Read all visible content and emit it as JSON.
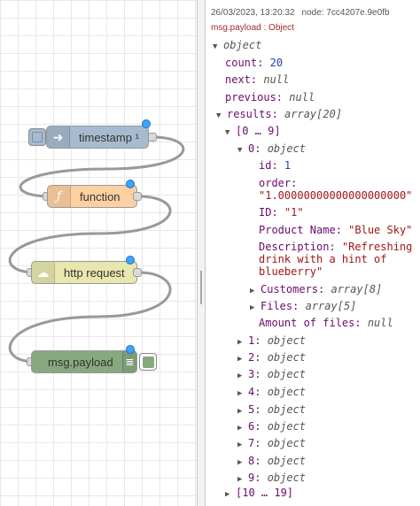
{
  "flow": {
    "nodes": [
      {
        "id": "timestamp",
        "label": "timestamp ¹",
        "color": "#a6bbcf",
        "icon": "arrow-icon"
      },
      {
        "id": "function",
        "label": "function",
        "color": "#fdd0a2",
        "icon": "function-icon"
      },
      {
        "id": "http",
        "label": "http request",
        "color": "#e7e7ae",
        "icon": "globe-icon"
      },
      {
        "id": "debug",
        "label": "msg.payload",
        "color": "#87a980",
        "icon": "list-icon"
      }
    ]
  },
  "debug": {
    "timestamp": "26/03/2023, 13:20:32",
    "node_label": "node: 7cc4207e.9e0fb",
    "topic": "msg.payload : Object",
    "root_type": "object",
    "count_key": "count:",
    "count_val": "20",
    "next_key": "next:",
    "next_val": "null",
    "previous_key": "previous:",
    "previous_val": "null",
    "results_key": "results:",
    "results_type": "array[20]",
    "range_open": "[0 … 9]",
    "item0_key": "0:",
    "item0_type": "object",
    "id_key": "id:",
    "id_val": "1",
    "order_key": "order:",
    "order_val": "\"1.00000000000000000000\"",
    "ID_key": "ID:",
    "ID_val": "\"1\"",
    "product_key": "Product Name:",
    "product_val": "\"Blue Sky\"",
    "desc_key": "Description:",
    "desc_val1": "\"Refreshing",
    "desc_val2": "drink with a hint of",
    "desc_val3": "blueberry\"",
    "customers_key": "Customers:",
    "customers_type": "array[8]",
    "files_key": "Files:",
    "files_type": "array[5]",
    "amount_key": "Amount of files:",
    "amount_val": "null",
    "items": [
      {
        "key": "1:",
        "type": "object"
      },
      {
        "key": "2:",
        "type": "object"
      },
      {
        "key": "3:",
        "type": "object"
      },
      {
        "key": "4:",
        "type": "object"
      },
      {
        "key": "5:",
        "type": "object"
      },
      {
        "key": "6:",
        "type": "object"
      },
      {
        "key": "7:",
        "type": "object"
      },
      {
        "key": "8:",
        "type": "object"
      },
      {
        "key": "9:",
        "type": "object"
      }
    ],
    "range_closed": "[10 … 19]"
  }
}
